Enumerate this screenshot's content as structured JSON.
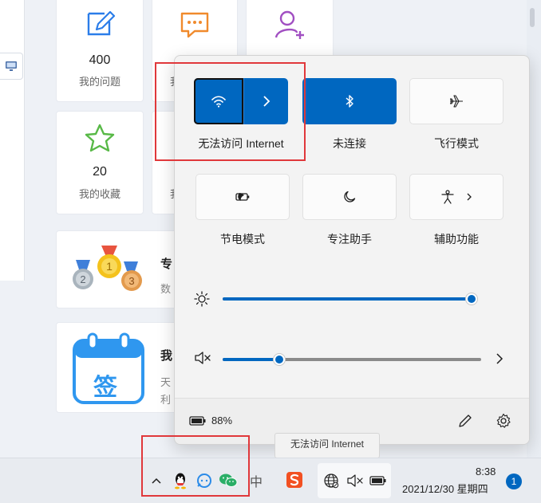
{
  "background_app": {
    "cards": [
      {
        "number": "400",
        "label": "我的问题",
        "icon": "note-edit-icon"
      },
      {
        "number": "",
        "label": "我",
        "icon": "chat-bubble-icon"
      },
      {
        "number": "",
        "label": "",
        "icon": "add-user-icon"
      },
      {
        "number": "20",
        "label": "我的收藏",
        "icon": "star-icon"
      },
      {
        "number": "",
        "label": "我",
        "icon": ""
      }
    ],
    "medal_card": {
      "title": "专",
      "subtitle": "数"
    },
    "sign_card": {
      "title": "我",
      "line1": "天",
      "line2": "利",
      "icon_text": "签"
    }
  },
  "quick_settings": {
    "tiles": [
      {
        "label": "无法访问 Internet",
        "state": "on",
        "icon": "wifi-icon"
      },
      {
        "label": "未连接",
        "state": "on",
        "icon": "bluetooth-icon"
      },
      {
        "label": "飞行模式",
        "state": "off",
        "icon": "airplane-icon"
      },
      {
        "label": "节电模式",
        "state": "off",
        "icon": "battery-saver-icon"
      },
      {
        "label": "专注助手",
        "state": "off",
        "icon": "moon-icon"
      },
      {
        "label": "辅助功能",
        "state": "off",
        "icon": "accessibility-icon"
      }
    ],
    "brightness_percent": 100,
    "volume_percent": 20,
    "volume_muted": true,
    "battery": "88%"
  },
  "tooltip": {
    "text": "无法访问 Internet"
  },
  "taskbar": {
    "ime_label": "中",
    "time": "8:38",
    "date": "2021/12/30 星期四",
    "notifications": "1"
  },
  "colors": {
    "accent": "#0067c0",
    "highlight": "#e0383b"
  }
}
